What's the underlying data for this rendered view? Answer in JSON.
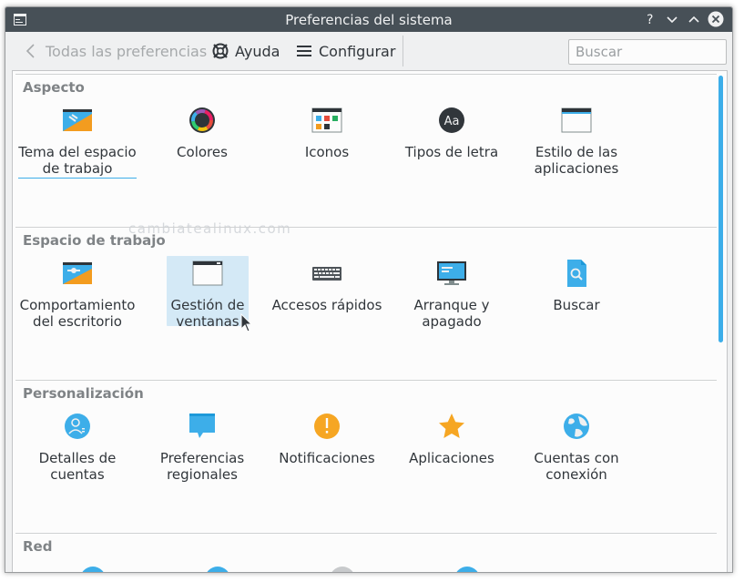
{
  "window": {
    "title": "Preferencias del sistema",
    "controls": [
      "help-icon",
      "minimize-icon",
      "maximize-icon",
      "close-icon"
    ]
  },
  "toolbar": {
    "back_label": "Todas las preferencias",
    "help_label": "Ayuda",
    "configure_label": "Configurar",
    "search_placeholder": "Buscar",
    "search_value": ""
  },
  "watermark": "cambiatealinux.com",
  "colors": {
    "titlebar": "#475057",
    "accent": "#3daee9",
    "hover": "#d4e9f6",
    "section_title": "#7f8386"
  },
  "sections": [
    {
      "title": "Aspecto",
      "items": [
        {
          "label": "Tema del espacio\nde trabajo",
          "icon": "workspace-theme-icon",
          "state": "focused"
        },
        {
          "label": "Colores",
          "icon": "colors-icon"
        },
        {
          "label": "Iconos",
          "icon": "icons-icon"
        },
        {
          "label": "Tipos de letra",
          "icon": "fonts-icon"
        },
        {
          "label": "Estilo de las\naplicaciones",
          "icon": "application-style-icon"
        }
      ]
    },
    {
      "title": "Espacio de trabajo",
      "items": [
        {
          "label": "Comportamiento\ndel escritorio",
          "icon": "desktop-behavior-icon"
        },
        {
          "label": "Gestión de\nventanas",
          "icon": "window-management-icon",
          "state": "hovered"
        },
        {
          "label": "Accesos rápidos",
          "icon": "keyboard-shortcuts-icon"
        },
        {
          "label": "Arranque y\napagado",
          "icon": "startup-shutdown-icon"
        },
        {
          "label": "Buscar",
          "icon": "search-settings-icon"
        }
      ]
    },
    {
      "title": "Personalización",
      "items": [
        {
          "label": "Detalles de\ncuentas",
          "icon": "account-details-icon"
        },
        {
          "label": "Preferencias\nregionales",
          "icon": "regional-settings-icon"
        },
        {
          "label": "Notificaciones",
          "icon": "notifications-icon"
        },
        {
          "label": "Aplicaciones",
          "icon": "applications-star-icon"
        },
        {
          "label": "Cuentas con\nconexión",
          "icon": "online-accounts-icon"
        }
      ]
    },
    {
      "title": "Red",
      "items": []
    }
  ]
}
